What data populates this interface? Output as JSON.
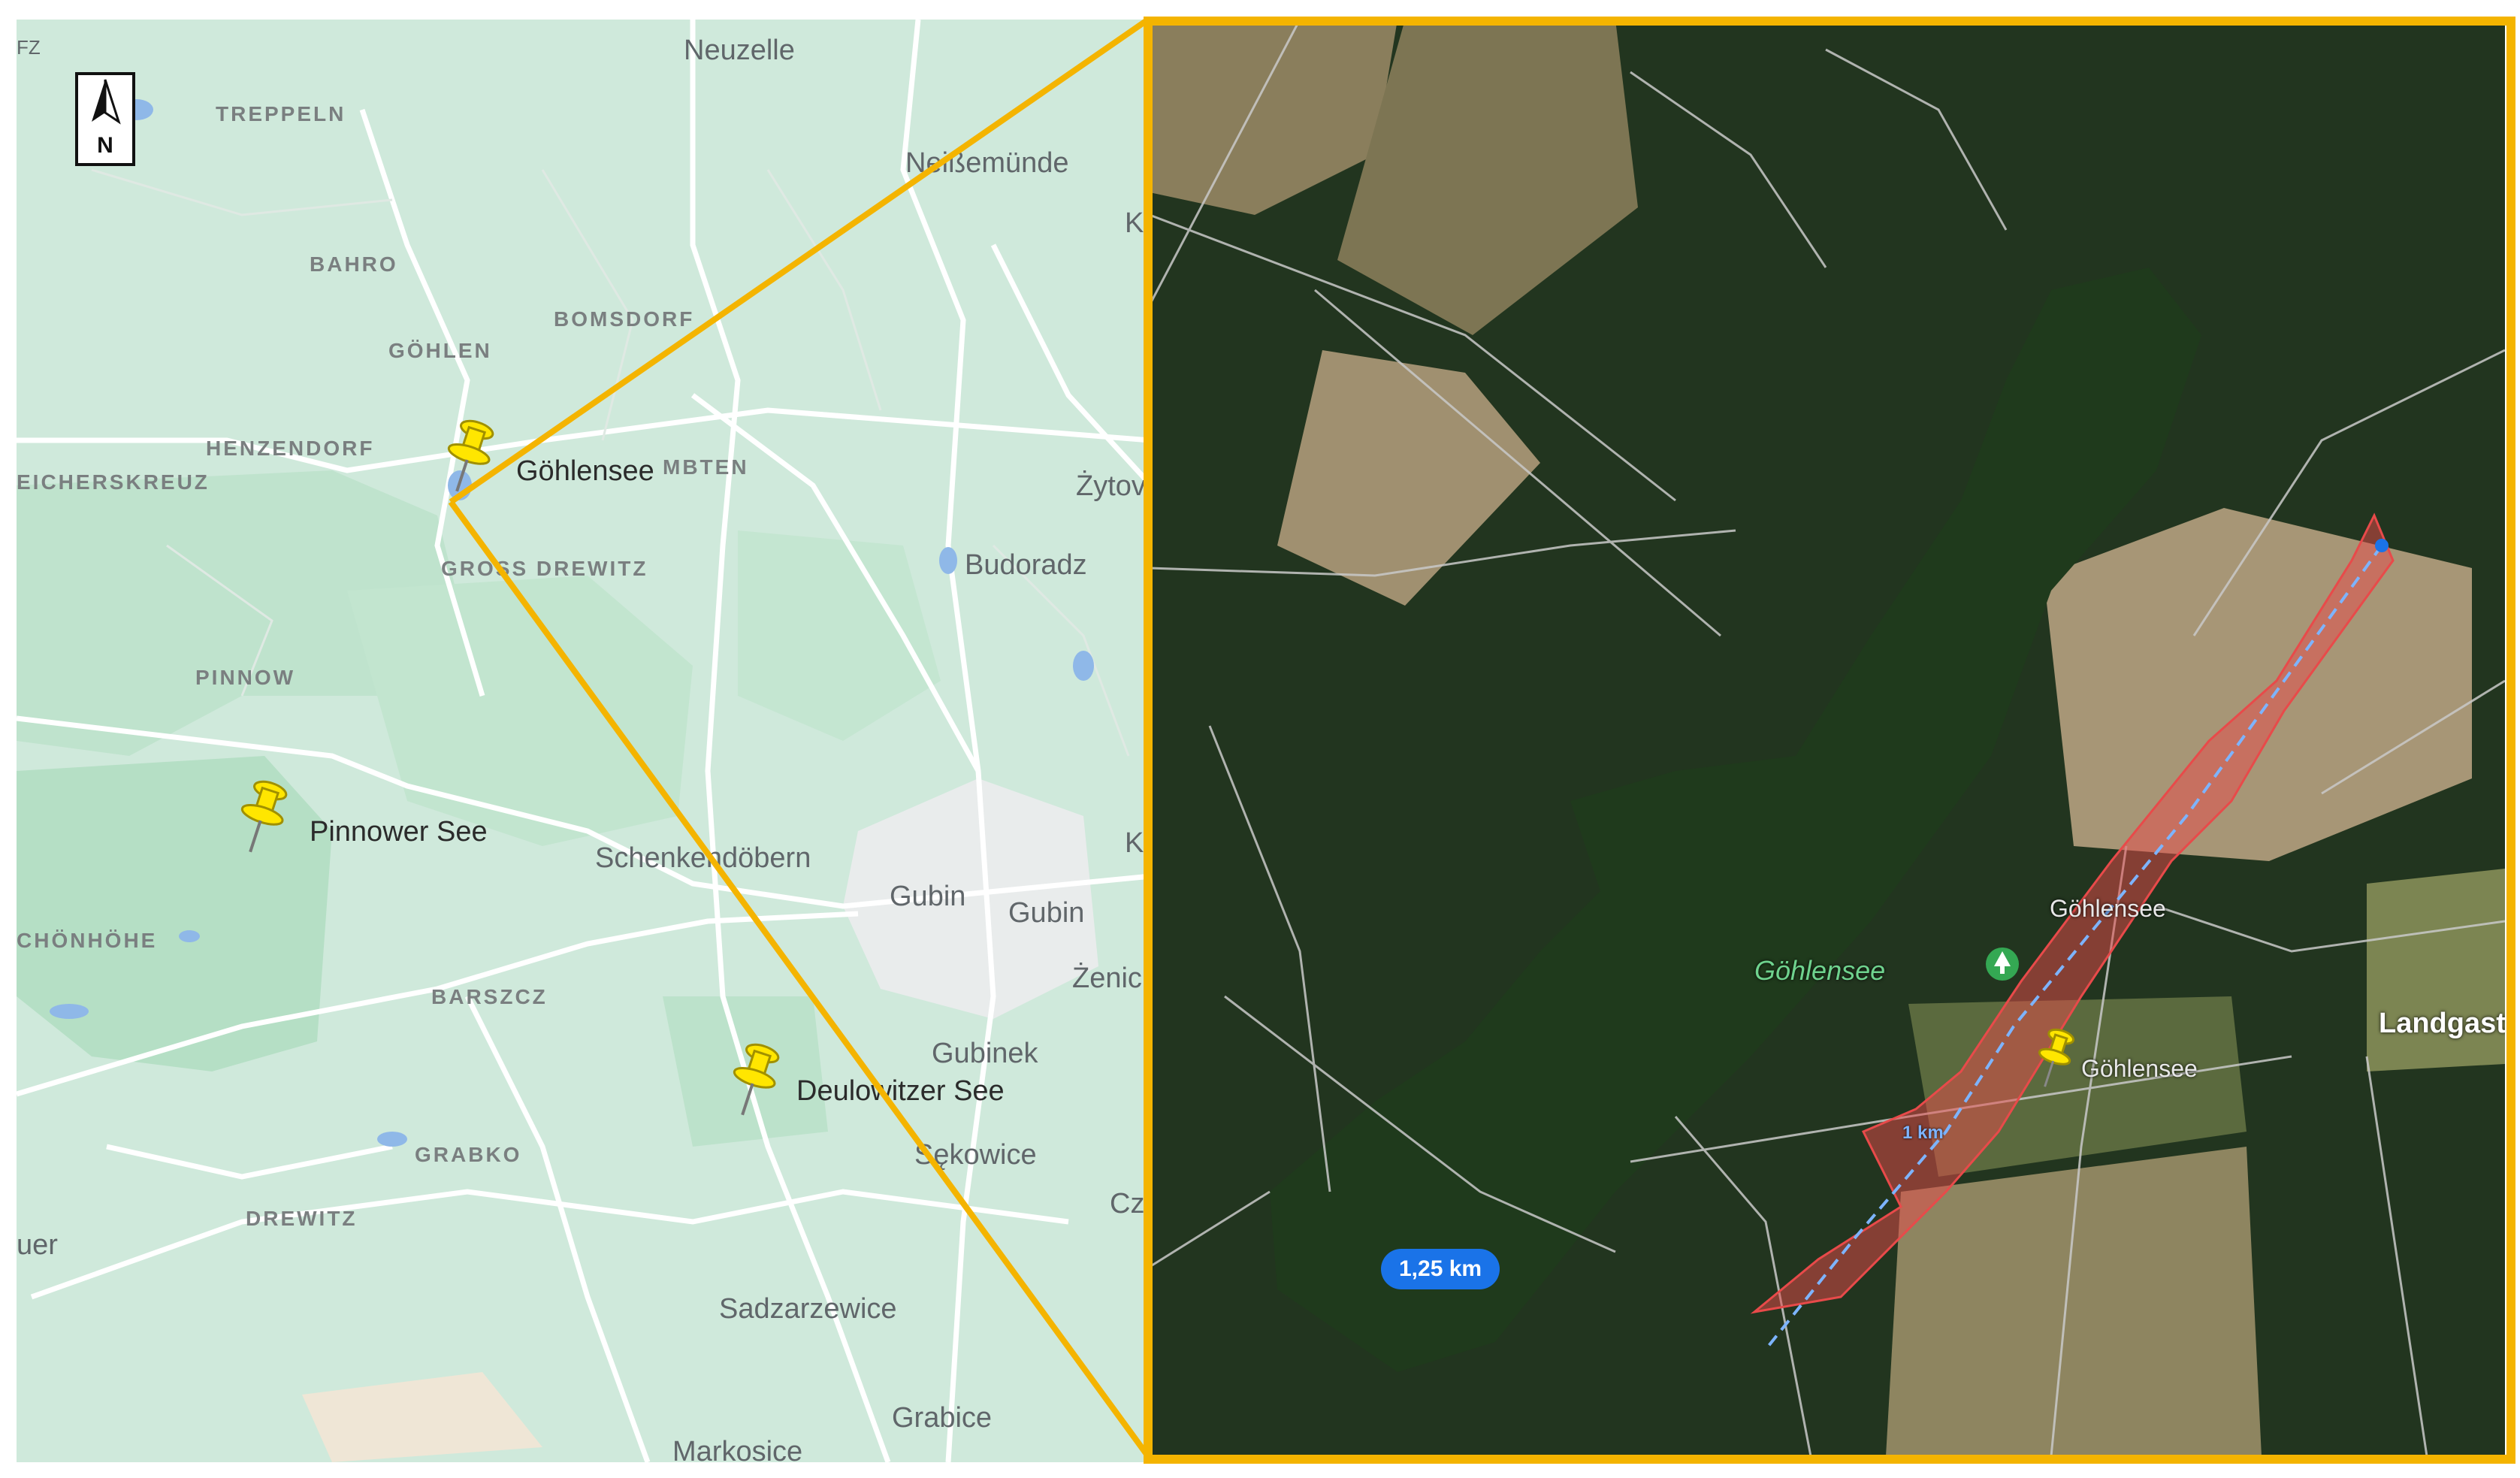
{
  "compass": {
    "letter": "N",
    "icon": "north-arrow-icon"
  },
  "left_map": {
    "villages": [
      "TREPPELN",
      "BAHRO",
      "BOMSDORF",
      "GÖHLEN",
      "HENZENDORF",
      "EICHERSKREUZ",
      "MBTEN",
      "GROSS DREWITZ",
      "PINNOW",
      "CHÖNHÖHE",
      "BARSZCZ",
      "GRABKO",
      "DREWITZ"
    ],
    "towns": [
      "Neuzelle",
      "Neißemünde",
      "Żytov",
      "Budoradz",
      "Schenkendöbern",
      "Gubin",
      "Gubin",
      "Gubinek",
      "Sękowice",
      "Sadzarzewice",
      "Grabice",
      "Markosice",
      "Żenic",
      "Cz",
      "K",
      "K",
      "uer",
      "FZ"
    ],
    "pins": [
      {
        "label": "Göhlensee",
        "icon": "yellow-pushpin-icon"
      },
      {
        "label": "Pinnower See",
        "icon": "yellow-pushpin-icon"
      },
      {
        "label": "Deulowitzer See",
        "icon": "yellow-pushpin-icon"
      }
    ]
  },
  "right_map": {
    "lake_label": "Göhlensee",
    "park_label": "Göhlensee",
    "pin_label": "Göhlensee",
    "hotel_label": "Landgasthof-Wagenburg",
    "distance_badge": "1,25 km",
    "km_marker": "1 km",
    "park_icon": "tree-icon",
    "hotel_icon": "bed-icon",
    "pin_icon": "yellow-pushpin-icon"
  },
  "colors": {
    "frame": "#f4b400",
    "transect": "#e84a4a",
    "measure": "#1a73e8",
    "park": "#34a853",
    "hotel": "#e8547a"
  }
}
